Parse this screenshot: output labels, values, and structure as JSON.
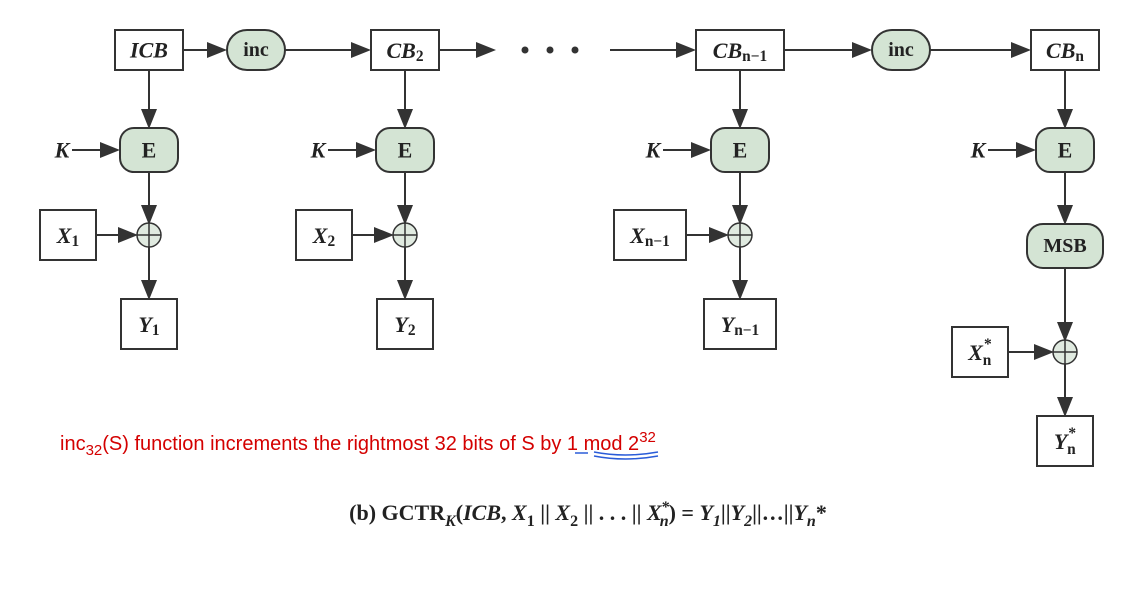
{
  "blocks": {
    "icb": "ICB",
    "inc1": "inc",
    "cb2": "CB",
    "cb2_sub": "2",
    "cbnm1": "CB",
    "cbnm1_sub": "n−1",
    "inc2": "inc",
    "cbn": "CB",
    "cbn_sub": "n",
    "E": "E",
    "K": "K",
    "msb": "MSB",
    "x1": "X",
    "x1_sub": "1",
    "x2": "X",
    "x2_sub": "2",
    "xnm1": "X",
    "xnm1_sub": "n−1",
    "xns": "X",
    "xns_sup": "*",
    "xns_sub": "n",
    "y1": "Y",
    "y1_sub": "1",
    "y2": "Y",
    "y2_sub": "2",
    "ynm1": "Y",
    "ynm1_sub": "n−1",
    "yns": "Y",
    "yns_sup": "*",
    "yns_sub": "n"
  },
  "annotation": {
    "pre": "inc",
    "sub": "32",
    "post": "(S) function increments the rightmost 32 bits of S by 1 mod 2",
    "sup": "32"
  },
  "caption": {
    "label": "(b) GCTR",
    "K": "K",
    "open": "(",
    "icb": "ICB",
    "comma": ", ",
    "X": "X",
    "s1": "1",
    "bar": " || ",
    "s2": "2",
    "dots": " || . . . || ",
    "Xn": "X",
    "star": "*",
    "n": "n",
    "close": ") = ",
    "Y": "Y",
    "ys1": "1",
    "ybar": "||",
    "ys2": "2",
    "ydots": "||…||",
    "Yn": "Y",
    "yn": "n",
    "ystar": "*"
  }
}
